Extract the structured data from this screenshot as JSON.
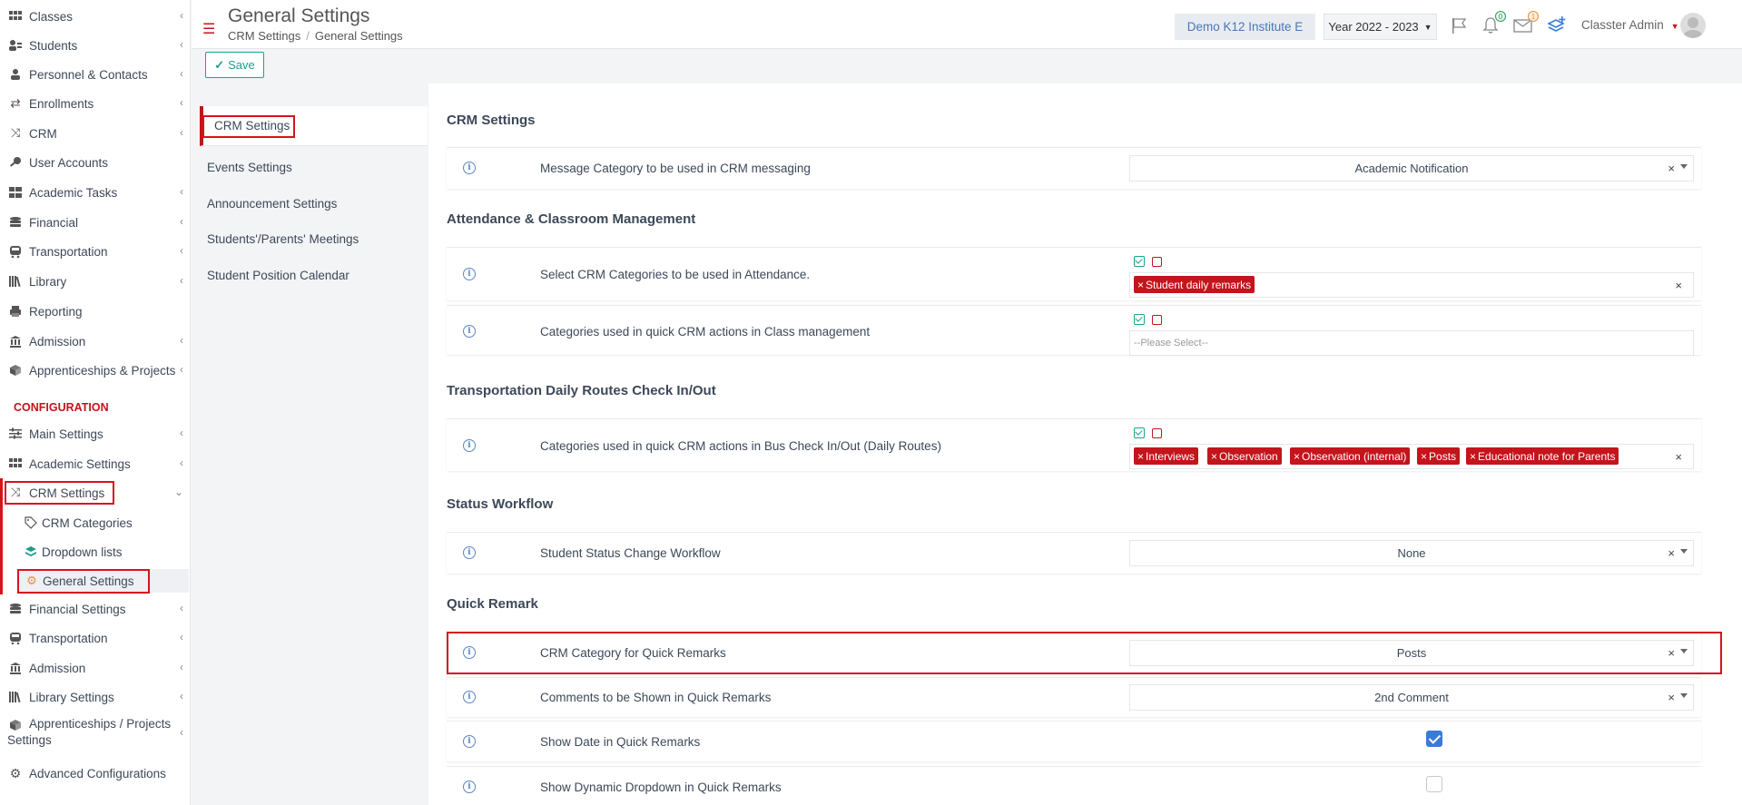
{
  "sidebar": {
    "items": [
      {
        "label": "Classes",
        "icon": "grid-icon"
      },
      {
        "label": "Students",
        "icon": "users-icon"
      },
      {
        "label": "Personnel & Contacts",
        "icon": "person-icon"
      },
      {
        "label": "Enrollments",
        "icon": "exchange-icon"
      },
      {
        "label": "CRM",
        "icon": "shuffle-icon"
      },
      {
        "label": "User Accounts",
        "icon": "key-icon"
      },
      {
        "label": "Academic Tasks",
        "icon": "tasks-icon"
      },
      {
        "label": "Financial",
        "icon": "coins-icon"
      },
      {
        "label": "Transportation",
        "icon": "bus-icon"
      },
      {
        "label": "Library",
        "icon": "books-icon"
      },
      {
        "label": "Reporting",
        "icon": "print-icon"
      },
      {
        "label": "Admission",
        "icon": "building-icon"
      },
      {
        "label": "Apprenticeships & Projects",
        "icon": "cube-icon"
      }
    ],
    "config_title": "CONFIGURATION",
    "config_items": [
      {
        "label": "Main Settings",
        "icon": "sliders-icon"
      },
      {
        "label": "Academic Settings",
        "icon": "grid-icon"
      },
      {
        "label": "CRM Settings",
        "icon": "shuffle-icon"
      }
    ],
    "crm_sub": [
      {
        "label": "CRM Categories",
        "icon": "tags-icon"
      },
      {
        "label": "Dropdown lists",
        "icon": "layers-icon"
      },
      {
        "label": "General Settings",
        "icon": "gear-icon"
      }
    ],
    "config_items_2": [
      {
        "label": "Financial Settings",
        "icon": "coins-icon"
      },
      {
        "label": "Transportation",
        "icon": "bus-icon"
      },
      {
        "label": "Admission",
        "icon": "building-icon"
      },
      {
        "label": "Library Settings",
        "icon": "books-icon"
      },
      {
        "label": "Apprenticeships / Projects",
        "label2": "Settings",
        "icon": "cube-icon"
      },
      {
        "label": "Advanced Configurations",
        "icon": "gears-icon"
      }
    ]
  },
  "header": {
    "title": "General Settings",
    "breadcrumb": [
      "CRM Settings",
      "General Settings"
    ],
    "institute": "Demo K12 Institute E",
    "year": "Year 2022 - 2023",
    "notifications_count": "0",
    "messages_count": "1",
    "user_name": "Classter Admin"
  },
  "toolbar": {
    "save_label": "Save"
  },
  "settings_nav": [
    "CRM Settings",
    "Events Settings",
    "Announcement Settings",
    "Students'/Parents' Meetings",
    "Student Position Calendar"
  ],
  "main": {
    "sections": {
      "crm": "CRM Settings",
      "attendance": "Attendance & Classroom Management",
      "transport": "Transportation Daily Routes Check In/Out",
      "status": "Status Workflow",
      "quick": "Quick Remark"
    },
    "rows": {
      "message_category": {
        "label": "Message Category to be used in CRM messaging",
        "value": "Academic Notification"
      },
      "attendance_categories": {
        "label": "Select CRM Categories to be used in Attendance.",
        "tags": [
          "Student daily remarks"
        ]
      },
      "class_mgmt_categories": {
        "label": "Categories used in quick CRM actions in Class management",
        "placeholder": "--Please Select--"
      },
      "bus_categories": {
        "label": "Categories used in quick CRM actions in Bus Check In/Out (Daily Routes)",
        "tags": [
          "Interviews",
          "Observation",
          "Observation (internal)",
          "Posts",
          "Educational note for Parents"
        ]
      },
      "status_workflow": {
        "label": "Student Status Change Workflow",
        "value": "None"
      },
      "quick_category": {
        "label": "CRM Category for Quick Remarks",
        "value": "Posts"
      },
      "quick_comments": {
        "label": "Comments to be Shown in Quick Remarks",
        "value": "2nd Comment"
      },
      "show_date": {
        "label": "Show Date in Quick Remarks",
        "checked": true
      },
      "show_dynamic": {
        "label": "Show Dynamic Dropdown in Quick Remarks",
        "checked": false
      }
    }
  },
  "colors": {
    "accent": "#c4141c",
    "save": "#18a48c",
    "link": "#4a76b8",
    "checkbox": "#3a7bd5"
  }
}
